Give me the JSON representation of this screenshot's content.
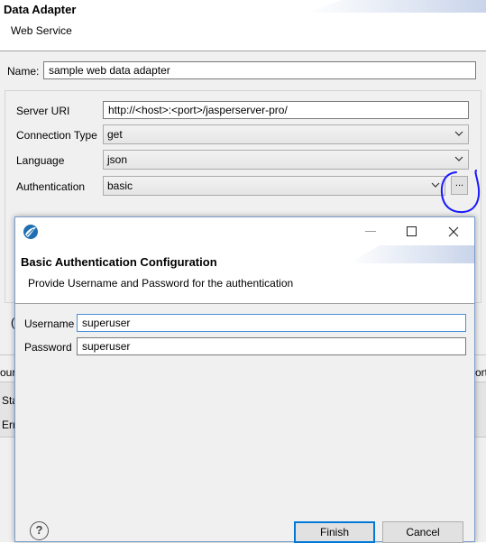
{
  "background_wizard": {
    "title": "Data Adapter",
    "subtitle": "Web Service",
    "name_label": "Name:",
    "name_value": "sample web data adapter",
    "server_uri_label": "Server URI",
    "server_uri_value": "http://<host>:<port>/jasperserver-pro/",
    "connection_type_label": "Connection Type",
    "connection_type_value": "get",
    "language_label": "Language",
    "language_value": "json",
    "authentication_label": "Authentication",
    "authentication_value": "basic",
    "auth_config_button": "...",
    "peek_left_1": "our",
    "peek_right_1": "ort",
    "peek_left_2": "Sta",
    "peek_left_3": "Err",
    "peek_left_4": "("
  },
  "dialog": {
    "title": "Basic Authentication Configuration",
    "subtitle": "Provide Username and Password for the authentication",
    "username_label": "Username",
    "username_value": "superuser",
    "password_label": "Password",
    "password_value": "superuser",
    "help_icon": "?",
    "finish_label": "Finish",
    "cancel_label": "Cancel",
    "window_controls": {
      "minimize_icon": "minimize-icon",
      "maximize_icon": "maximize-icon",
      "close_icon": "close-icon"
    }
  },
  "colors": {
    "annotation_circle": "#1a1aff",
    "focus_border": "#4a90d9",
    "default_button_border": "#0078d7"
  }
}
